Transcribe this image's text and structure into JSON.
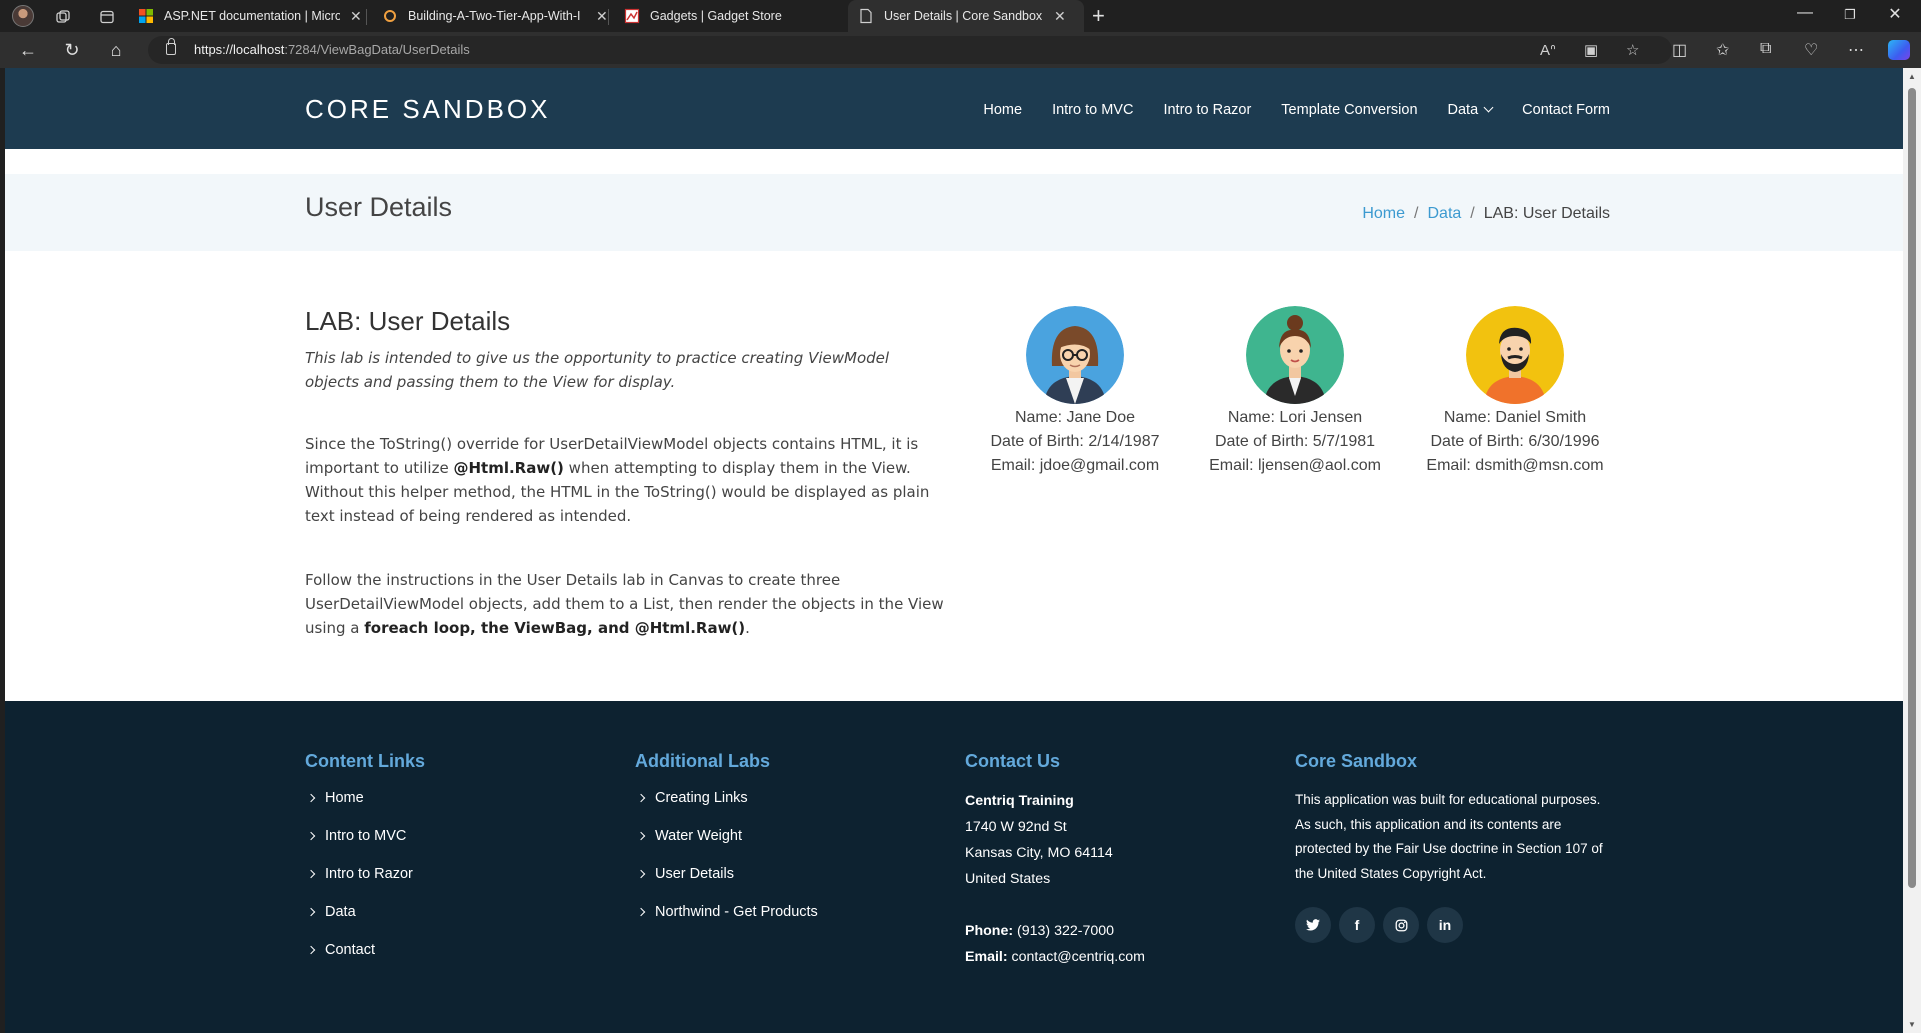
{
  "browser": {
    "tabs": [
      {
        "title": "ASP.NET documentation | Micros"
      },
      {
        "title": "Building-A-Two-Tier-App-With-I"
      },
      {
        "title": "Gadgets | Gadget Store"
      },
      {
        "title": "User Details | Core Sandbox"
      }
    ],
    "url_host": "https://localhost",
    "url_path": ":7284/ViewBagData/UserDetails"
  },
  "site": {
    "logo": "CORE SANDBOX",
    "nav": [
      "Home",
      "Intro to MVC",
      "Intro to Razor",
      "Template Conversion",
      "Data",
      "Contact Form"
    ]
  },
  "title_bar": {
    "title": "User Details",
    "breadcrumb": {
      "home": "Home",
      "data": "Data",
      "current": "LAB: User Details"
    }
  },
  "lab": {
    "title": "LAB: User Details",
    "intro": "This lab is intended to give us the opportunity to practice creating ViewModel objects and passing them to the View for display.",
    "p1_a": "Since the ToString() override for UserDetailViewModel objects contains HTML, it is important to utilize ",
    "p1_b": "@Html.Raw()",
    "p1_c": " when attempting to display them in the View. Without this helper method, the HTML in the ToString() would be displayed as plain text instead of being rendered as intended.",
    "p2_a": "Follow the instructions in the User Details lab in Canvas to create three UserDetailViewModel objects, add them to a List, then render the objects in the View using a ",
    "p2_b": "foreach loop, the ViewBag, and @Html.Raw()",
    "p2_c": "."
  },
  "users": [
    {
      "name": "Name: Jane Doe",
      "dob": "Date of Birth: 2/14/1987",
      "email": "Email: jdoe@gmail.com",
      "avatar_bg": "#4aa3df"
    },
    {
      "name": "Name: Lori Jensen",
      "dob": "Date of Birth: 5/7/1981",
      "email": "Email: ljensen@aol.com",
      "avatar_bg": "#3fb58f"
    },
    {
      "name": "Name: Daniel Smith",
      "dob": "Date of Birth: 6/30/1996",
      "email": "Email: dsmith@msn.com",
      "avatar_bg": "#f2c20f"
    }
  ],
  "footer": {
    "content_links": {
      "heading": "Content Links",
      "items": [
        "Home",
        "Intro to MVC",
        "Intro to Razor",
        "Data",
        "Contact"
      ]
    },
    "additional_labs": {
      "heading": "Additional Labs",
      "items": [
        "Creating Links",
        "Water Weight",
        "User Details",
        "Northwind - Get Products"
      ]
    },
    "contact": {
      "heading": "Contact Us",
      "org": "Centriq Training",
      "street": "1740 W 92nd St",
      "city": "Kansas City, MO 64114",
      "country": "United States",
      "phone_label": "Phone:",
      "phone": " (913) 322-7000",
      "email_label": "Email:",
      "email": " contact@centriq.com"
    },
    "about": {
      "heading": "Core Sandbox",
      "text": "This application was built for educational purposes. As such, this application and its contents are protected by the Fair Use doctrine in Section 107 of the United States Copyright Act."
    },
    "socials": [
      "twitter-icon",
      "facebook-icon",
      "instagram-icon",
      "linkedin-icon"
    ]
  },
  "colors": {
    "header": "#1d3b50",
    "footer": "#0d2230",
    "accent": "#63a9db",
    "link": "#3c9ad0"
  }
}
